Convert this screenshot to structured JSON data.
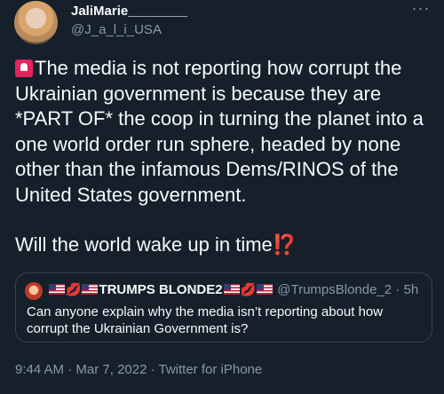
{
  "author": {
    "display_name": "JaliMarie________",
    "handle": "@J_a_l_i_USA"
  },
  "tweet": {
    "line1": "The media is not reporting how corrupt the Ukrainian government is because they are *PART OF* the coop in turning the planet into a one world order run sphere, headed by none other than the infamous Dems/RINOS of the United States government.",
    "line2": "Will the world wake up in time",
    "line2_end": "⁉️"
  },
  "quoted": {
    "name": "TRUMPS BLONDE2",
    "handle": "@TrumpsBlonde_2",
    "separator": " · ",
    "time": "5h",
    "text": "Can anyone explain why the media isn’t reporting  about how corrupt the Ukrainian Government is?"
  },
  "meta": {
    "time": "9:44 AM",
    "separator": " · ",
    "date": "Mar 7, 2022",
    "source": "Twitter for iPhone"
  },
  "more_label": "···",
  "icons": [
    "siren-icon",
    "us-flag-icon",
    "lips-icon",
    "more-icon"
  ],
  "colors": {
    "background": "#15202b",
    "secondary_text": "#8b98a5",
    "border": "#38444d"
  }
}
